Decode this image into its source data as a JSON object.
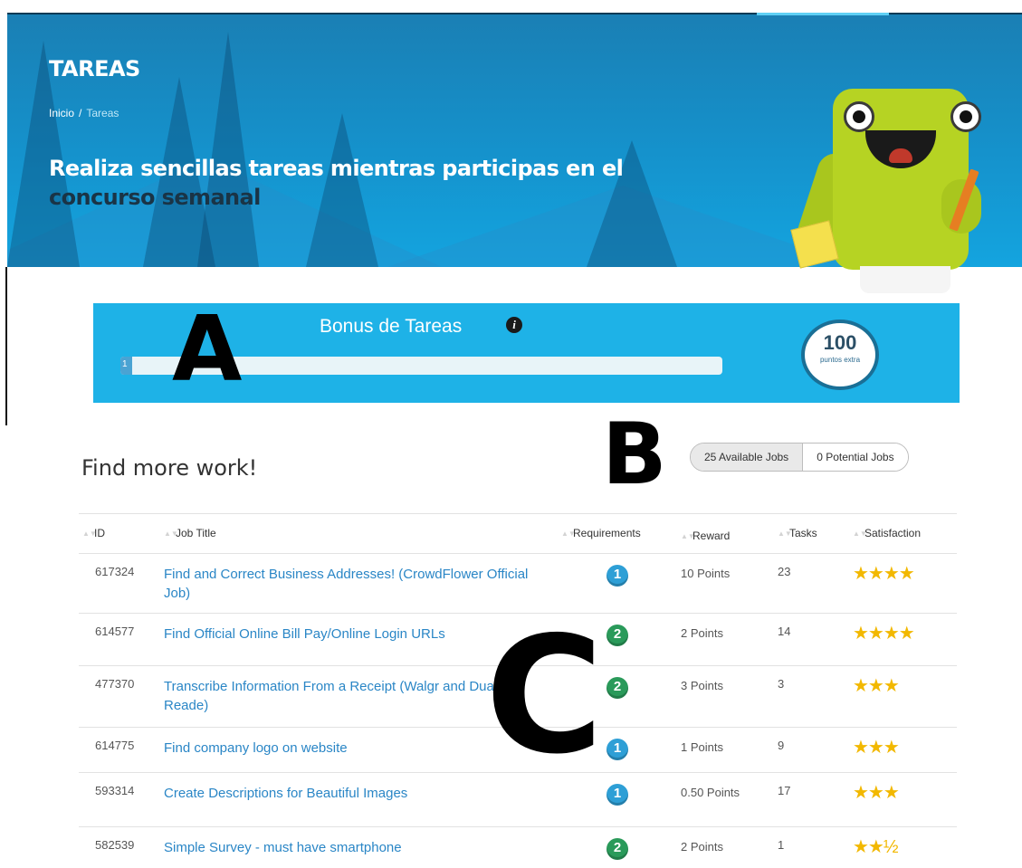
{
  "banner": {
    "title": "TAREAS",
    "breadcrumb": {
      "home": "Inicio",
      "separator": "/",
      "current": "Tareas"
    },
    "headline_prefix": "Realiza sencillas tareas mientras participas en el ",
    "headline_highlight": "concurso semanal"
  },
  "bonus": {
    "title": "Bonus de Tareas",
    "progress_fraction": 0.02,
    "progress_label": "1",
    "badge_value": "100",
    "badge_caption": "puntos extra"
  },
  "overlays": {
    "a": "A",
    "b": "B",
    "c": "C"
  },
  "jobs": {
    "heading": "Find more work!",
    "toggle": {
      "available": "25 Available Jobs",
      "potential": "0 Potential Jobs"
    },
    "columns": {
      "id": "ID",
      "title": "Job Title",
      "requirements": "Requirements",
      "reward": "Reward",
      "tasks": "Tasks",
      "satisfaction": "Satisfaction"
    },
    "rows": [
      {
        "id": "617324",
        "title": "Find and Correct Business Addresses! (CrowdFlower Official Job)",
        "level": "1",
        "reward": "10 Points",
        "tasks": "23",
        "stars": "★★★★"
      },
      {
        "id": "614577",
        "title": "Find Official Online Bill Pay/Online Login URLs",
        "level": "2",
        "reward": "2 Points",
        "tasks": "14",
        "stars": "★★★★"
      },
      {
        "id": "477370",
        "title": "Transcribe Information From a Receipt (Walgr and Duane Reade)",
        "level": "2",
        "reward": "3 Points",
        "tasks": "3",
        "stars": "★★★"
      },
      {
        "id": "614775",
        "title": "Find company logo on website",
        "level": "1",
        "reward": "1 Points",
        "tasks": "9",
        "stars": "★★★"
      },
      {
        "id": "593314",
        "title": "Create Descriptions for Beautiful Images",
        "level": "1",
        "reward": "0.50 Points",
        "tasks": "17",
        "stars": "★★★"
      },
      {
        "id": "582539",
        "title": "Simple Survey - must have smartphone",
        "level": "2",
        "reward": "2 Points",
        "tasks": "1",
        "stars": "★★½"
      }
    ]
  },
  "colors": {
    "banner": "#1592cc",
    "bonus_panel": "#1eb2e7",
    "link": "#2a86c6",
    "star": "#f2b800",
    "level1": "#2e9fd6",
    "level2": "#2a9a5a"
  }
}
